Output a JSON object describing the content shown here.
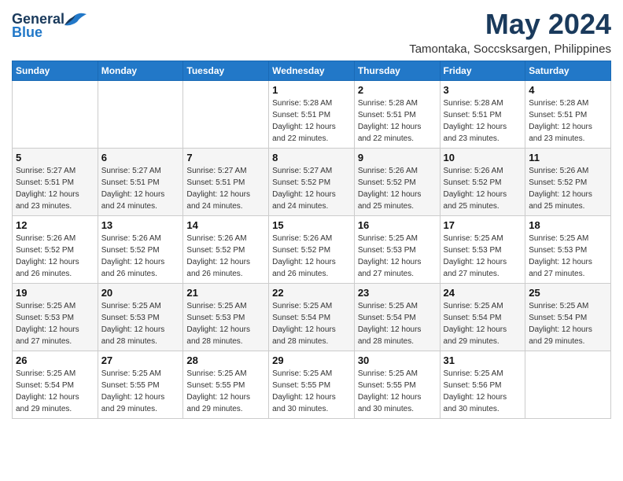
{
  "logo": {
    "general": "General",
    "blue": "Blue"
  },
  "title": "May 2024",
  "subtitle": "Tamontaka, Soccsksargen, Philippines",
  "days_of_week": [
    "Sunday",
    "Monday",
    "Tuesday",
    "Wednesday",
    "Thursday",
    "Friday",
    "Saturday"
  ],
  "weeks": [
    [
      {
        "day": "",
        "info": ""
      },
      {
        "day": "",
        "info": ""
      },
      {
        "day": "",
        "info": ""
      },
      {
        "day": "1",
        "info": "Sunrise: 5:28 AM\nSunset: 5:51 PM\nDaylight: 12 hours\nand 22 minutes."
      },
      {
        "day": "2",
        "info": "Sunrise: 5:28 AM\nSunset: 5:51 PM\nDaylight: 12 hours\nand 22 minutes."
      },
      {
        "day": "3",
        "info": "Sunrise: 5:28 AM\nSunset: 5:51 PM\nDaylight: 12 hours\nand 23 minutes."
      },
      {
        "day": "4",
        "info": "Sunrise: 5:28 AM\nSunset: 5:51 PM\nDaylight: 12 hours\nand 23 minutes."
      }
    ],
    [
      {
        "day": "5",
        "info": "Sunrise: 5:27 AM\nSunset: 5:51 PM\nDaylight: 12 hours\nand 23 minutes."
      },
      {
        "day": "6",
        "info": "Sunrise: 5:27 AM\nSunset: 5:51 PM\nDaylight: 12 hours\nand 24 minutes."
      },
      {
        "day": "7",
        "info": "Sunrise: 5:27 AM\nSunset: 5:51 PM\nDaylight: 12 hours\nand 24 minutes."
      },
      {
        "day": "8",
        "info": "Sunrise: 5:27 AM\nSunset: 5:52 PM\nDaylight: 12 hours\nand 24 minutes."
      },
      {
        "day": "9",
        "info": "Sunrise: 5:26 AM\nSunset: 5:52 PM\nDaylight: 12 hours\nand 25 minutes."
      },
      {
        "day": "10",
        "info": "Sunrise: 5:26 AM\nSunset: 5:52 PM\nDaylight: 12 hours\nand 25 minutes."
      },
      {
        "day": "11",
        "info": "Sunrise: 5:26 AM\nSunset: 5:52 PM\nDaylight: 12 hours\nand 25 minutes."
      }
    ],
    [
      {
        "day": "12",
        "info": "Sunrise: 5:26 AM\nSunset: 5:52 PM\nDaylight: 12 hours\nand 26 minutes."
      },
      {
        "day": "13",
        "info": "Sunrise: 5:26 AM\nSunset: 5:52 PM\nDaylight: 12 hours\nand 26 minutes."
      },
      {
        "day": "14",
        "info": "Sunrise: 5:26 AM\nSunset: 5:52 PM\nDaylight: 12 hours\nand 26 minutes."
      },
      {
        "day": "15",
        "info": "Sunrise: 5:26 AM\nSunset: 5:52 PM\nDaylight: 12 hours\nand 26 minutes."
      },
      {
        "day": "16",
        "info": "Sunrise: 5:25 AM\nSunset: 5:53 PM\nDaylight: 12 hours\nand 27 minutes."
      },
      {
        "day": "17",
        "info": "Sunrise: 5:25 AM\nSunset: 5:53 PM\nDaylight: 12 hours\nand 27 minutes."
      },
      {
        "day": "18",
        "info": "Sunrise: 5:25 AM\nSunset: 5:53 PM\nDaylight: 12 hours\nand 27 minutes."
      }
    ],
    [
      {
        "day": "19",
        "info": "Sunrise: 5:25 AM\nSunset: 5:53 PM\nDaylight: 12 hours\nand 27 minutes."
      },
      {
        "day": "20",
        "info": "Sunrise: 5:25 AM\nSunset: 5:53 PM\nDaylight: 12 hours\nand 28 minutes."
      },
      {
        "day": "21",
        "info": "Sunrise: 5:25 AM\nSunset: 5:53 PM\nDaylight: 12 hours\nand 28 minutes."
      },
      {
        "day": "22",
        "info": "Sunrise: 5:25 AM\nSunset: 5:54 PM\nDaylight: 12 hours\nand 28 minutes."
      },
      {
        "day": "23",
        "info": "Sunrise: 5:25 AM\nSunset: 5:54 PM\nDaylight: 12 hours\nand 28 minutes."
      },
      {
        "day": "24",
        "info": "Sunrise: 5:25 AM\nSunset: 5:54 PM\nDaylight: 12 hours\nand 29 minutes."
      },
      {
        "day": "25",
        "info": "Sunrise: 5:25 AM\nSunset: 5:54 PM\nDaylight: 12 hours\nand 29 minutes."
      }
    ],
    [
      {
        "day": "26",
        "info": "Sunrise: 5:25 AM\nSunset: 5:54 PM\nDaylight: 12 hours\nand 29 minutes."
      },
      {
        "day": "27",
        "info": "Sunrise: 5:25 AM\nSunset: 5:55 PM\nDaylight: 12 hours\nand 29 minutes."
      },
      {
        "day": "28",
        "info": "Sunrise: 5:25 AM\nSunset: 5:55 PM\nDaylight: 12 hours\nand 29 minutes."
      },
      {
        "day": "29",
        "info": "Sunrise: 5:25 AM\nSunset: 5:55 PM\nDaylight: 12 hours\nand 30 minutes."
      },
      {
        "day": "30",
        "info": "Sunrise: 5:25 AM\nSunset: 5:55 PM\nDaylight: 12 hours\nand 30 minutes."
      },
      {
        "day": "31",
        "info": "Sunrise: 5:25 AM\nSunset: 5:56 PM\nDaylight: 12 hours\nand 30 minutes."
      },
      {
        "day": "",
        "info": ""
      }
    ]
  ]
}
